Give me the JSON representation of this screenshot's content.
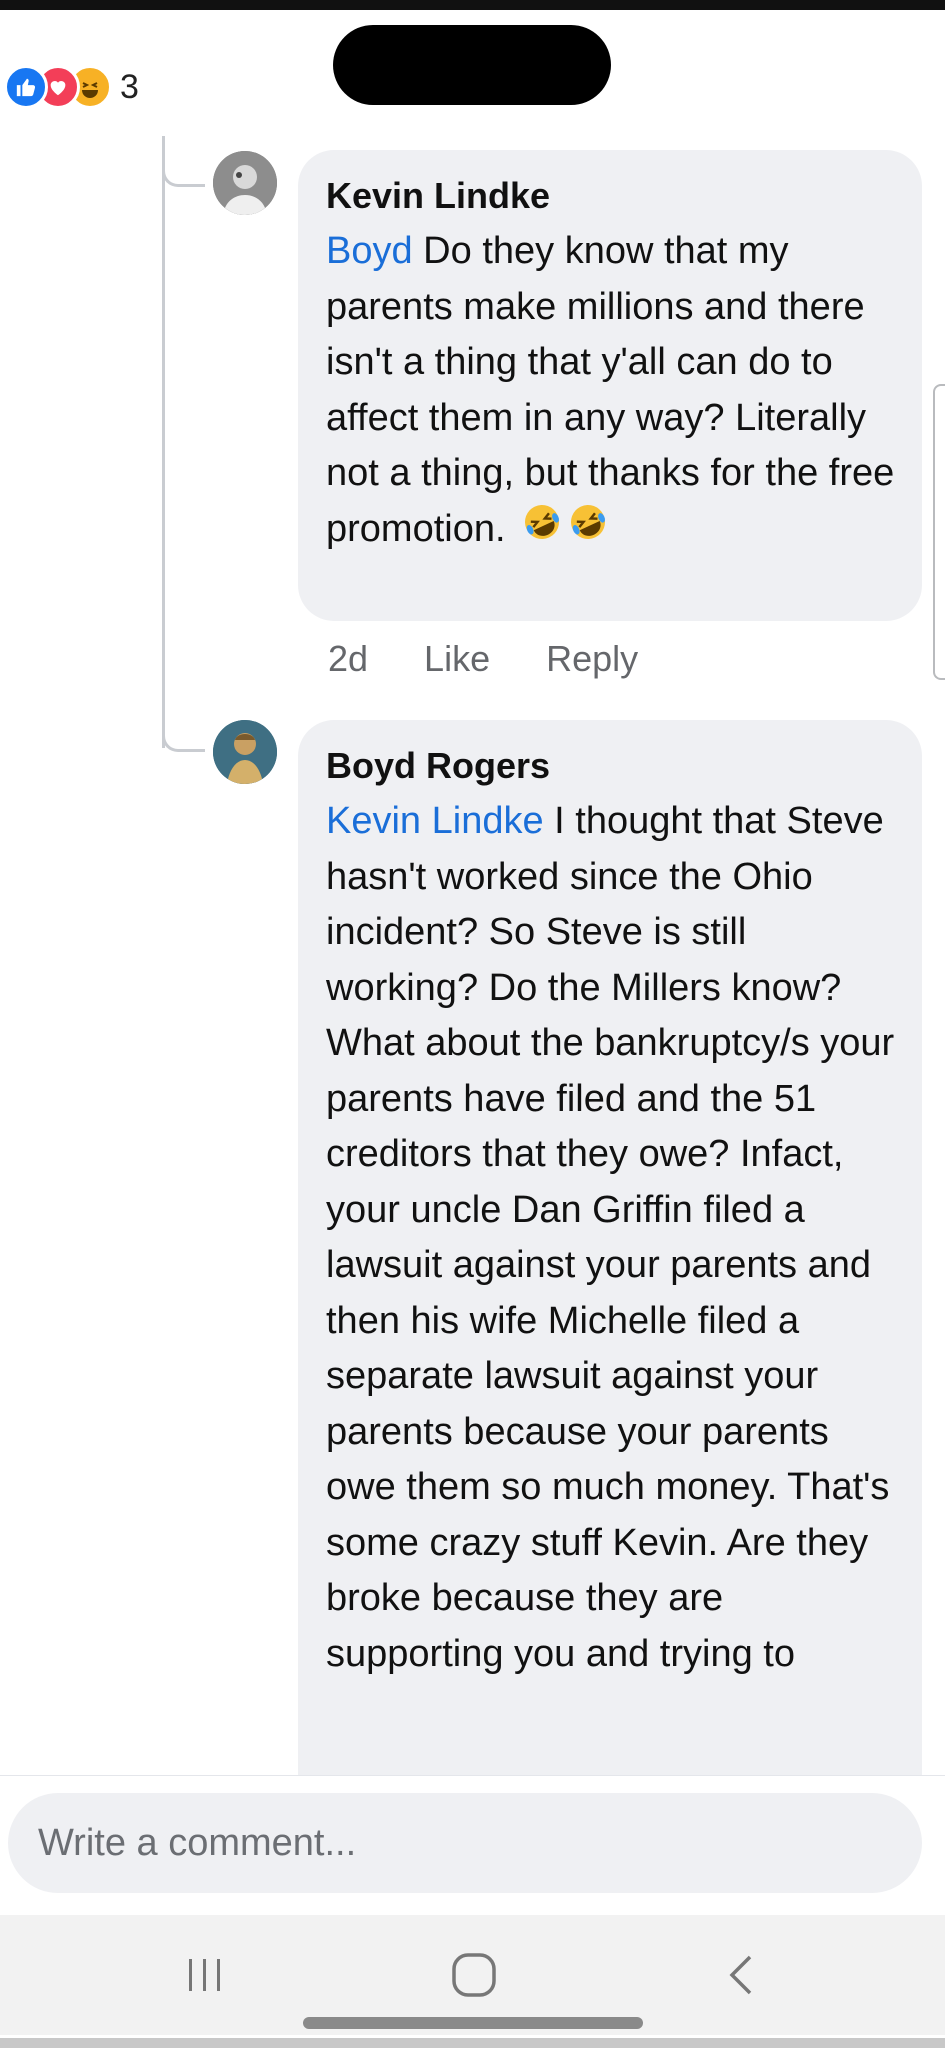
{
  "reactions": {
    "types": [
      "like-icon",
      "love-icon",
      "haha-icon"
    ],
    "count": "3"
  },
  "comments": [
    {
      "author": "Kevin Lindke",
      "mention": "Boyd",
      "text": " Do they know that my parents make millions and there isn't a thing that y'all can do to affect them in any way? Literally not a thing, but thanks for the free promotion. ",
      "emoji": [
        "rolling-laughing-emoji",
        "rolling-laughing-emoji"
      ],
      "time": "2d",
      "like_label": "Like",
      "reply_label": "Reply"
    },
    {
      "author": "Boyd Rogers",
      "mention": "Kevin Lindke",
      "text": " I thought that Steve hasn't worked since the Ohio incident? So Steve is still working? Do the Millers know? What about the bankruptcy/s your parents have filed and the 51 creditors that they owe? Infact, your uncle Dan Griffin filed a lawsuit against your parents and then his wife Michelle filed a separate lawsuit against your parents because your parents owe them so much money. That's some crazy stuff Kevin. Are they broke because they are supporting you and trying to"
    }
  ],
  "composer": {
    "placeholder": "Write a comment..."
  },
  "colors": {
    "mention": "#1a6ed8",
    "bubble": "#eff0f3",
    "like": "#1877f2",
    "love": "#f33e58",
    "haha": "#f7b125"
  }
}
